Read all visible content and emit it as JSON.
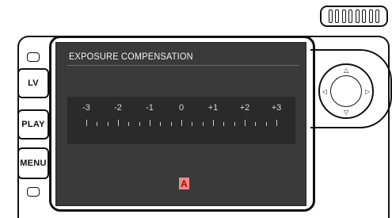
{
  "screen": {
    "title": "EXPOSURE COMPENSATION",
    "scale_labels": [
      "-3",
      "-2",
      "-1",
      "0",
      "+1",
      "+2",
      "+3"
    ],
    "marker_text": "A",
    "marker_color": "#f08a8a"
  },
  "buttons": {
    "lv": "LV",
    "play": "PLAY",
    "menu": "MENU"
  },
  "pad": {
    "up_icon": "triangle-up-icon",
    "down_icon": "triangle-down-icon",
    "left_icon": "triangle-left-icon",
    "right_icon": "triangle-right-icon"
  }
}
